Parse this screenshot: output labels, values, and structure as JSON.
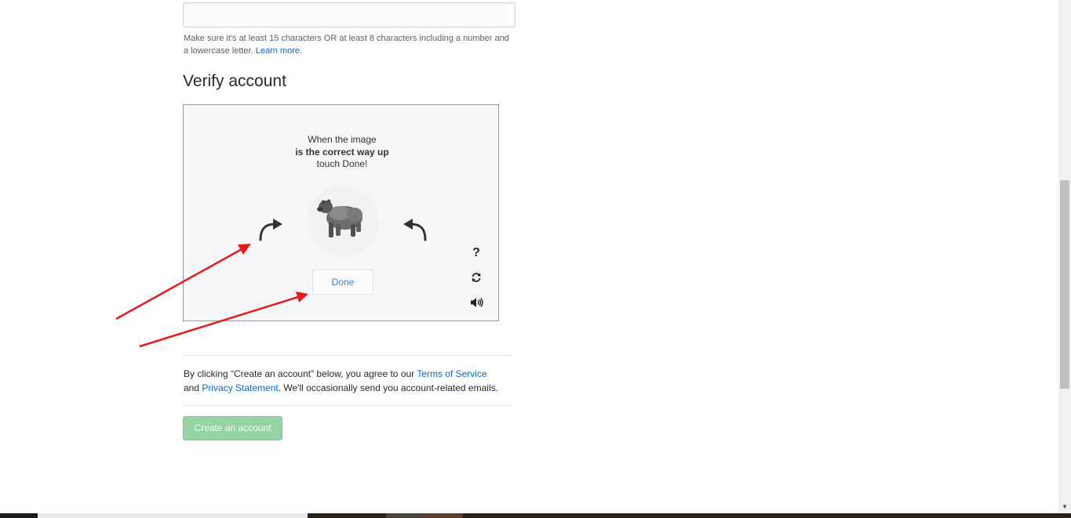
{
  "form": {
    "password_value": "",
    "password_hint_text": "Make sure it's at least 15 characters OR at least 8 characters including a number and a lowercase letter. ",
    "learn_more_link": "Learn more."
  },
  "verify": {
    "title": "Verify account",
    "instruction_line1": "When the image",
    "instruction_line2": "is the correct way up",
    "instruction_line3": "touch Done!",
    "done_button": "Done",
    "help_symbol": "?",
    "rotate_left_icon": "rotate-left-icon",
    "rotate_right_icon": "rotate-right-icon",
    "image_subject": "bear",
    "refresh_icon": "refresh-icon",
    "audio_icon": "audio-icon"
  },
  "terms": {
    "text_before": "By clicking “Create an account” below, you agree to our ",
    "terms_link": "Terms of Service",
    "text_and": "and ",
    "privacy_link": "Privacy Statement",
    "text_after": ". We'll occasionally send you account-related emails."
  },
  "create_button": "Create an account",
  "colors": {
    "link": "#0366d6",
    "button_disabled_green": "#94d3a2",
    "annotation_arrow": "#e81a1a"
  }
}
